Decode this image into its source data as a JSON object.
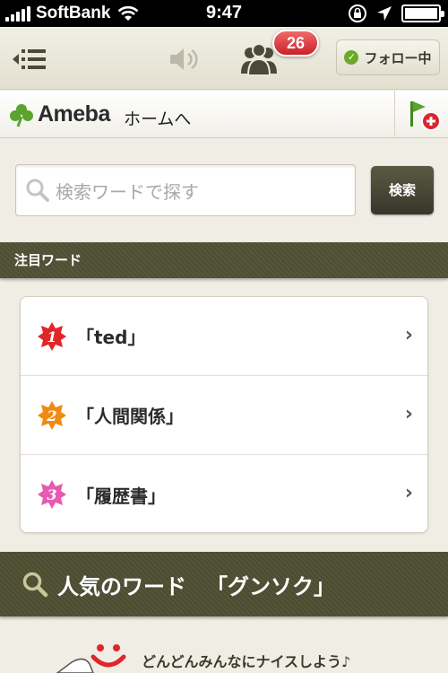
{
  "status_bar": {
    "carrier": "SoftBank",
    "time": "9:47"
  },
  "navbar": {
    "notification_count": "26",
    "follow_label": "フォロー中"
  },
  "ameba": {
    "logo_text": "Ameba",
    "home_label": "ホームへ"
  },
  "search": {
    "placeholder": "検索ワードで探す",
    "button_label": "検索"
  },
  "trending": {
    "header": "注目ワード",
    "items": [
      {
        "rank": "1",
        "word": "「ted」",
        "color": "#e0262a"
      },
      {
        "rank": "2",
        "word": "「人間関係」",
        "color": "#f08a12"
      },
      {
        "rank": "3",
        "word": "「履歴書」",
        "color": "#e85ab0"
      }
    ]
  },
  "popular": {
    "label": "人気のワード",
    "word": "「グンソク」"
  },
  "promo": {
    "text": "どんどんみんなにナイスしよう♪"
  }
}
